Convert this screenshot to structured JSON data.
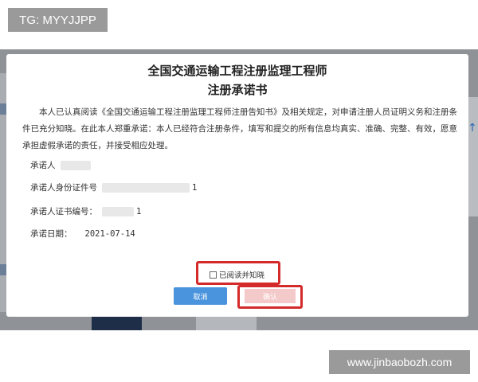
{
  "watermark_top": "TG: MYYJJPP",
  "watermark_bottom": "www.jinbaobozh.com",
  "modal": {
    "title_line1": "全国交通运输工程注册监理工程师",
    "title_line2": "注册承诺书",
    "statement": "本人已认真阅读《全国交通运输工程注册监理工程师注册告知书》及相关规定，对申请注册人员证明义务和注册条件已充分知晓。在此本人郑重承诺：本人已经符合注册条件，填写和提交的所有信息均真实、准确、完整、有效，愿意承担虚假承诺的责任，并接受相应处理。",
    "fields": {
      "promiser_label": "承诺人",
      "id_label": "承诺人身份证件号",
      "id_tail": "1",
      "cert_label": "承诺人证书编号：",
      "cert_tail": "1",
      "date_label": "承诺日期：",
      "date_value": "2021-07-14"
    },
    "agree_label": "已阅读并知晓",
    "cancel_label": "取消",
    "confirm_label": "确认"
  },
  "colors": {
    "overlay": "#8f9296",
    "highlight_red": "#d42a2a",
    "cancel_blue": "#4a94dd",
    "confirm_disabled": "#f4c9c9"
  }
}
